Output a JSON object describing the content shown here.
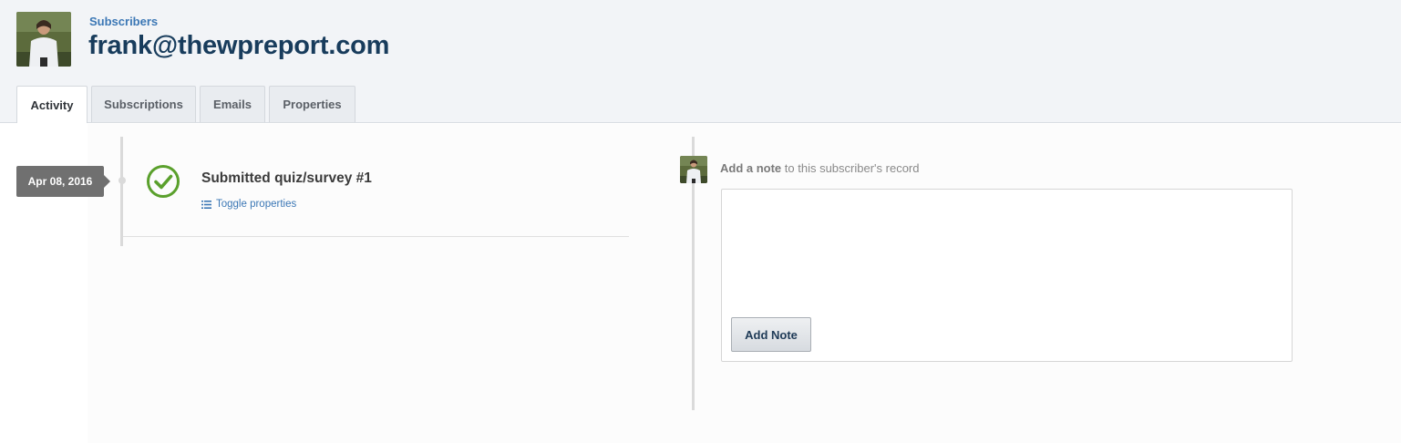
{
  "header": {
    "breadcrumb": "Subscribers",
    "title": "frank@thewpreport.com"
  },
  "tabs": [
    {
      "label": "Activity",
      "active": true
    },
    {
      "label": "Subscriptions",
      "active": false
    },
    {
      "label": "Emails",
      "active": false
    },
    {
      "label": "Properties",
      "active": false
    }
  ],
  "timeline": {
    "date": "Apr 08, 2016",
    "event_title": "Submitted quiz/survey #1",
    "event_icon": "check-circle-icon",
    "toggle_label": "Toggle properties"
  },
  "note": {
    "prompt_bold": "Add a note",
    "prompt_rest": " to this subscriber's record",
    "input_value": "",
    "button_label": "Add Note"
  },
  "colors": {
    "link": "#3b77b5",
    "title": "#183c5c",
    "success": "#5aa02c",
    "badge": "#707070"
  }
}
